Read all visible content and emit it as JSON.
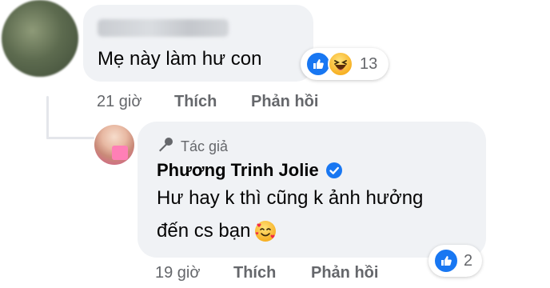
{
  "comment1": {
    "text": "Mẹ này làm hư con",
    "reaction_icons": [
      "like-icon",
      "haha-icon"
    ],
    "reaction_count": "13",
    "time": "21 giờ",
    "like_label": "Thích",
    "reply_label": "Phản hồi"
  },
  "comment2": {
    "author_badge": "Tác giả",
    "author_name": "Phương Trinh Jolie",
    "text_line1": "Hư hay k thì cũng k ảnh hưởng",
    "text_line2": "đến cs bạn",
    "emoji": "smiling-face-with-hearts",
    "reaction_icons": [
      "like-icon"
    ],
    "reaction_count": "2",
    "time": "19 giờ",
    "like_label": "Thích",
    "reply_label": "Phản hồi"
  },
  "colors": {
    "bubble_bg": "#f0f2f5",
    "secondary_text": "#65676b",
    "like_blue": "#1877f2"
  }
}
